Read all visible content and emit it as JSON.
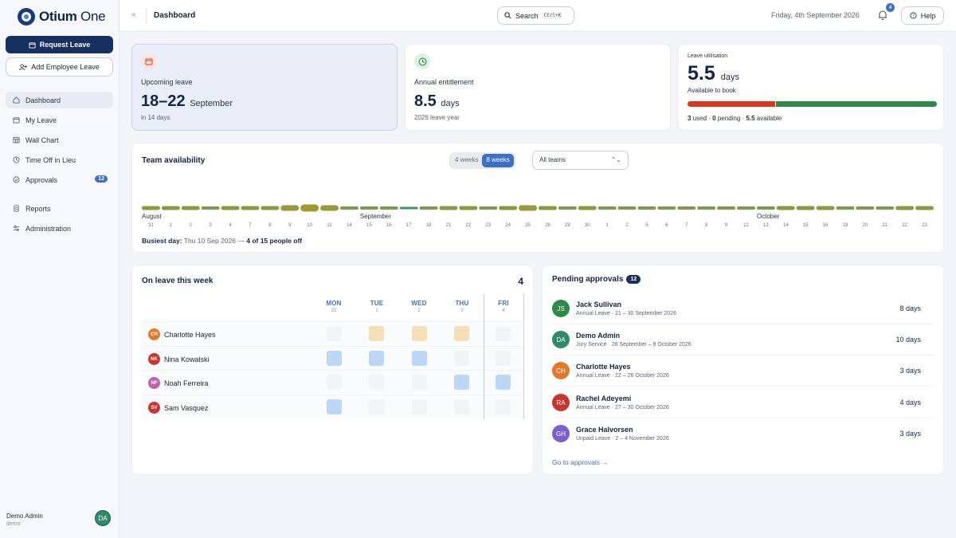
{
  "app": {
    "logo_strong": "Otium",
    "logo_light": " One"
  },
  "sidebar": {
    "request_leave": "Request Leave",
    "add_employee_leave": "Add Employee Leave",
    "nav": [
      {
        "label": "Dashboard",
        "icon": "home-icon",
        "active": true
      },
      {
        "label": "My Leave",
        "icon": "calendar-icon"
      },
      {
        "label": "Wall Chart",
        "icon": "grid-calendar-icon"
      },
      {
        "label": "Time Off in Lieu",
        "icon": "clock-icon"
      },
      {
        "label": "Approvals",
        "icon": "check-circle-icon",
        "badge": "12"
      },
      {
        "label": "Reports",
        "icon": "document-icon"
      },
      {
        "label": "Administration",
        "icon": "sliders-icon"
      }
    ],
    "user": {
      "name": "Demo Admin",
      "sub": "demo",
      "initials": "DA"
    }
  },
  "header": {
    "breadcrumb": "Dashboard",
    "search_label": "Search",
    "search_shortcut": "Ctrl+K",
    "date": "Friday, 4th September 2026",
    "notifications": "4",
    "help": "Help"
  },
  "kpis": {
    "upcoming": {
      "label": "Upcoming leave",
      "value": "18–22",
      "unit": "September",
      "sub": "in 14 days"
    },
    "entitlement": {
      "label": "Annual entitlement",
      "value": "8.5",
      "unit": "days",
      "sub": "2026 leave year"
    },
    "utilisation": {
      "title": "Leave utilisation",
      "value": "5.5",
      "unit": "days",
      "sub": "Available to book",
      "used": "3",
      "used_label": "used",
      "pending": "0",
      "pending_label": "pending",
      "available": "5.5",
      "available_label": "available",
      "used_fraction": 0.353,
      "colors": {
        "used": "#d8391c",
        "available": "#2f8a4a"
      }
    }
  },
  "team_availability": {
    "title": "Team availability",
    "range_options": [
      "4 weeks",
      "8 weeks"
    ],
    "selected_range": "8 weeks",
    "team_filter": "All teams",
    "months": [
      {
        "label": "August",
        "index": 0
      },
      {
        "label": "September",
        "index": 11
      },
      {
        "label": "October",
        "index": 31
      }
    ],
    "days": [
      "31",
      "1",
      "2",
      "3",
      "4",
      "7",
      "8",
      "9",
      "10",
      "11",
      "14",
      "15",
      "16",
      "17",
      "18",
      "21",
      "22",
      "23",
      "24",
      "25",
      "28",
      "29",
      "30",
      "1",
      "2",
      "5",
      "6",
      "7",
      "8",
      "9",
      "12",
      "13",
      "14",
      "15",
      "16",
      "19",
      "20",
      "21",
      "22",
      "23"
    ],
    "levels": [
      2,
      2,
      2,
      1,
      2,
      2,
      2,
      3,
      4,
      3,
      1,
      1,
      1,
      0,
      1,
      2,
      2,
      1,
      2,
      3,
      2,
      1,
      2,
      1,
      1,
      1,
      1,
      1,
      1,
      1,
      1,
      1,
      2,
      2,
      2,
      1,
      1,
      1,
      2,
      2
    ],
    "busiest_label": "Busiest day:",
    "busiest_date": "Thu 10 Sep 2026 —",
    "busiest_count": "4 of 15 people off"
  },
  "on_leave_week": {
    "title": "On leave this week",
    "count": "4",
    "days": [
      {
        "day": "MON",
        "num": "31"
      },
      {
        "day": "TUE",
        "num": "1"
      },
      {
        "day": "WED",
        "num": "2"
      },
      {
        "day": "THU",
        "num": "3"
      },
      {
        "day": "FRI",
        "num": "4"
      }
    ],
    "people": [
      {
        "name": "Charlotte Hayes",
        "initials": "CH",
        "color": "#e07b2e",
        "cells": [
          "none",
          "amber",
          "amber",
          "amber",
          "none"
        ]
      },
      {
        "name": "Nina Kowalski",
        "initials": "NK",
        "color": "#c8362f",
        "cells": [
          "blue",
          "blue",
          "blue",
          "none",
          "none"
        ]
      },
      {
        "name": "Noah Ferreira",
        "initials": "NF",
        "color": "#c060b0",
        "cells": [
          "none",
          "none",
          "none",
          "blue",
          "blue"
        ]
      },
      {
        "name": "Sam Vasquez",
        "initials": "SV",
        "color": "#c8362f",
        "cells": [
          "blue",
          "none",
          "none",
          "none",
          "none"
        ]
      }
    ]
  },
  "pending_approvals": {
    "title": "Pending approvals",
    "count": "12",
    "items": [
      {
        "name": "Jack Sullivan",
        "initials": "JS",
        "color": "#2f8a4a",
        "detail": "Annual Leave · 21 – 30 September 2026",
        "days": "8 days"
      },
      {
        "name": "Demo Admin",
        "initials": "DA",
        "color": "#2f8a6a",
        "detail": "Jury Service · 28 September – 9 October 2026",
        "days": "10 days"
      },
      {
        "name": "Charlotte Hayes",
        "initials": "CH",
        "color": "#e07b2e",
        "detail": "Annual Leave · 22 – 26 October 2026",
        "days": "3 days"
      },
      {
        "name": "Rachel Adeyemi",
        "initials": "RA",
        "color": "#c8362f",
        "detail": "Annual Leave · 27 – 30 October 2026",
        "days": "4 days"
      },
      {
        "name": "Grace Halvorsen",
        "initials": "GH",
        "color": "#7a5fd0",
        "detail": "Unpaid Leave · 2 – 4 November 2026",
        "days": "3 days"
      }
    ],
    "link": "Go to approvals →"
  }
}
